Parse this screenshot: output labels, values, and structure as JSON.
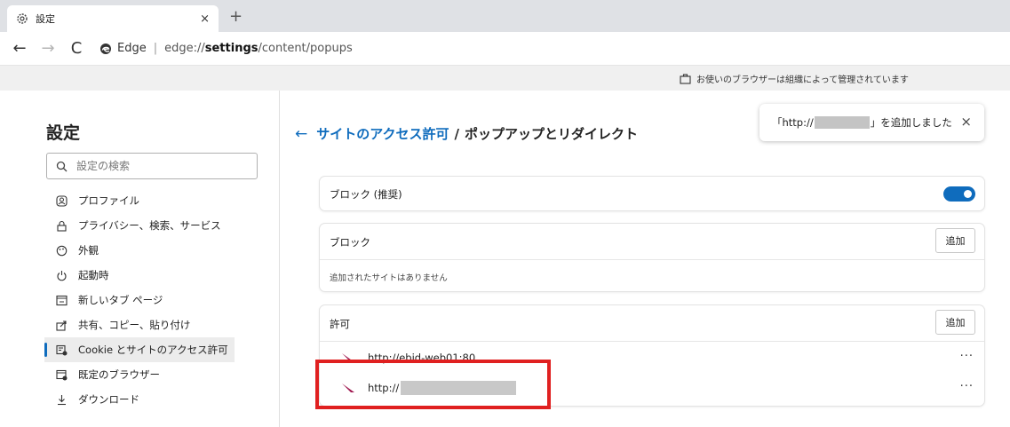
{
  "tab": {
    "title": "設定",
    "close": "×",
    "new_tab": "+"
  },
  "toolbar": {
    "back": "←",
    "forward": "→",
    "refresh": "C",
    "browser_label": "Edge",
    "separator": "|",
    "url_prefix": "edge://",
    "url_bold": "settings",
    "url_suffix": "/content/popups"
  },
  "banner": {
    "text": "お使いのブラウザーは組織によって管理されています"
  },
  "sidebar": {
    "title": "設定",
    "search_placeholder": "設定の検索",
    "items": [
      {
        "label": "プロファイル",
        "icon": "profile-icon"
      },
      {
        "label": "プライバシー、検索、サービス",
        "icon": "lock-icon"
      },
      {
        "label": "外観",
        "icon": "appearance-icon"
      },
      {
        "label": "起動時",
        "icon": "power-icon"
      },
      {
        "label": "新しいタブ ページ",
        "icon": "newtab-icon"
      },
      {
        "label": "共有、コピー、貼り付け",
        "icon": "share-icon"
      },
      {
        "label": "Cookie とサイトのアクセス許可",
        "icon": "cookie-icon",
        "active": true
      },
      {
        "label": "既定のブラウザー",
        "icon": "default-browser-icon"
      },
      {
        "label": "ダウンロード",
        "icon": "download-icon"
      }
    ]
  },
  "breadcrumb": {
    "parent": "サイトのアクセス許可",
    "separator": "/",
    "current": "ポップアップとリダイレクト"
  },
  "toast": {
    "prefix": "「http://",
    "suffix": "」を追加しました",
    "close": "×"
  },
  "block_toggle": {
    "label": "ブロック (推奨)",
    "enabled": true
  },
  "block_section": {
    "title": "ブロック",
    "add": "追加",
    "empty": "追加されたサイトはありません"
  },
  "allow_section": {
    "title": "許可",
    "add": "追加",
    "sites": [
      {
        "url": "http://ebid-web01:80",
        "more": "···"
      },
      {
        "url": "http://",
        "more": "···"
      }
    ]
  },
  "colors": {
    "accent": "#0f6cbd",
    "highlight": "#e02020"
  }
}
